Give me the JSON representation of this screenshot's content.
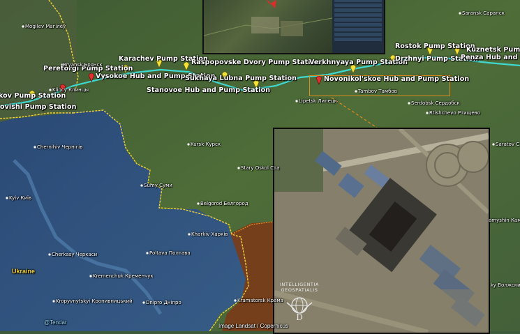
{
  "colors": {
    "pipeline": "#3fd8d0",
    "border": "#f2d23a",
    "highlight": "#e08a1a",
    "russia_land": "#4c6b36",
    "ukraine_land": "#33527a",
    "occupied": "#7a3c1a"
  },
  "stations": [
    {
      "name": "kov Pump Station",
      "marker": "yellow-pin"
    },
    {
      "name": "ovishi Pump Station",
      "marker": "none"
    },
    {
      "name": "Peretorgi Pump Station",
      "marker": "none"
    },
    {
      "name": "Karachev Pump Station",
      "marker": "yellow-pin"
    },
    {
      "name": "Vysokoe Hub and Pump Station",
      "marker": "red-pin"
    },
    {
      "name": "Raspopovske Dvory Pump Station",
      "marker": "yellow-pin"
    },
    {
      "name": "Sukhaya Lubna Pump Station",
      "marker": "yellow-pin"
    },
    {
      "name": "Stanovoe Hub and Pump Station",
      "marker": "yellow-pin"
    },
    {
      "name": "Verkhnyaya Pump Station",
      "marker": "yellow-pin"
    },
    {
      "name": "Novonikol'skoe Hub and Pump Station",
      "marker": "red-pin"
    },
    {
      "name": "Rostok Pump Station",
      "marker": "yellow-pin"
    },
    {
      "name": "Drzhnyi Pump Station",
      "marker": "yellow-pin"
    },
    {
      "name": "Kuznetsk Pump S",
      "marker": "yellow-pin"
    },
    {
      "name": "Penza Hub and Pu",
      "marker": "none"
    }
  ],
  "cities": [
    "Mogilev Магілёў",
    "Bryansk Брянск",
    "Klincy Клинцы",
    "Saransk Саранск",
    "Lipetsk Липецк",
    "Tambov Тамбов",
    "Serdobsk Сердобск",
    "Rtishchevo Ртищево",
    "Chernihiv Чернігів",
    "Kursk Курск",
    "Stary Oskol Ста",
    "Sumy Суми",
    "Kyiv Київ",
    "Belgorod Белгород",
    "Kharkiv Харків",
    "Cherkasy Черкаси",
    "Poltava Полтава",
    "Kremenchuk Кременчук",
    "Kropyvnytskyi Кропивницький",
    "Dnipro Дніпро",
    "Kramatorsk Крама",
    "Saratov С",
    "amyshin Камыш",
    "ky Волжский"
  ],
  "country_label": "Ukraine",
  "credits": {
    "handle": "@Tendar",
    "imagery": "Image Landsat / Copernicus"
  },
  "logo": {
    "line1": "INTELLIGENTIA",
    "line2": "GEOSPATIALIS",
    "mark": "D"
  }
}
